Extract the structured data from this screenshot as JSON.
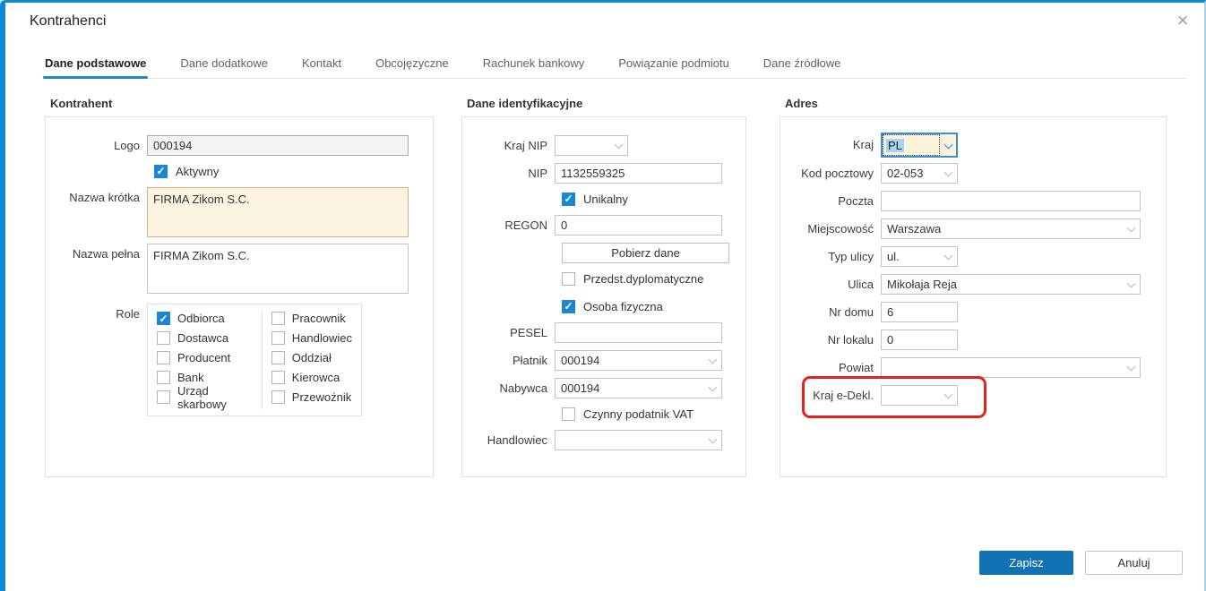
{
  "dialog": {
    "title": "Kontrahenci",
    "close_glyph": "×"
  },
  "tabs": [
    {
      "label": "Dane podstawowe",
      "active": true
    },
    {
      "label": "Dane dodatkowe",
      "active": false
    },
    {
      "label": "Kontakt",
      "active": false
    },
    {
      "label": "Obcojęzyczne",
      "active": false
    },
    {
      "label": "Rachunek bankowy",
      "active": false
    },
    {
      "label": "Powiązanie podmiotu",
      "active": false
    },
    {
      "label": "Dane źródłowe",
      "active": false
    }
  ],
  "kontrahent": {
    "header": "Kontrahent",
    "logo_label": "Logo",
    "logo_value": "000194",
    "aktywny_label": "Aktywny",
    "aktywny_checked": true,
    "nazwa_krotka_label": "Nazwa krótka",
    "nazwa_krotka_value": "FIRMA Zikom S.C.",
    "nazwa_pelna_label": "Nazwa pełna",
    "nazwa_pelna_value": "FIRMA Zikom S.C.",
    "role_label": "Role",
    "role_col1": [
      {
        "label": "Odbiorca",
        "checked": true
      },
      {
        "label": "Dostawca",
        "checked": false
      },
      {
        "label": "Producent",
        "checked": false
      },
      {
        "label": "Bank",
        "checked": false
      },
      {
        "label": "Urząd skarbowy",
        "checked": false
      }
    ],
    "role_col2": [
      {
        "label": "Pracownik",
        "checked": false
      },
      {
        "label": "Handlowiec",
        "checked": false
      },
      {
        "label": "Oddział",
        "checked": false
      },
      {
        "label": "Kierowca",
        "checked": false
      },
      {
        "label": "Przewoźnik",
        "checked": false
      }
    ]
  },
  "ident": {
    "header": "Dane identyfikacyjne",
    "kraj_nip_label": "Kraj NIP",
    "kraj_nip_value": "",
    "nip_label": "NIP",
    "nip_value": "1132559325",
    "unikalny_label": "Unikalny",
    "unikalny_checked": true,
    "regon_label": "REGON",
    "regon_value": "0",
    "pobierz_dane_label": "Pobierz dane",
    "przedst_label": "Przedst.dyplomatyczne",
    "przedst_checked": false,
    "osoba_fizyczna_label": "Osoba fizyczna",
    "osoba_fizyczna_checked": true,
    "pesel_label": "PESEL",
    "pesel_value": "",
    "platnik_label": "Płatnik",
    "platnik_value": "000194",
    "nabywca_label": "Nabywca",
    "nabywca_value": "000194",
    "vat_label": "Czynny podatnik VAT",
    "vat_checked": false,
    "handlowiec_label": "Handlowiec",
    "handlowiec_value": ""
  },
  "adres": {
    "header": "Adres",
    "kraj_label": "Kraj",
    "kraj_value": "PL",
    "kod_pocztowy_label": "Kod pocztowy",
    "kod_pocztowy_value": "02-053",
    "poczta_label": "Poczta",
    "poczta_value": "",
    "miejscowosc_label": "Miejscowość",
    "miejscowosc_value": "Warszawa",
    "typ_ulicy_label": "Typ ulicy",
    "typ_ulicy_value": "ul.",
    "ulica_label": "Ulica",
    "ulica_value": "Mikołaja Reja",
    "nr_domu_label": "Nr domu",
    "nr_domu_value": "6",
    "nr_lokalu_label": "Nr lokalu",
    "nr_lokalu_value": "0",
    "powiat_label": "Powiat",
    "powiat_value": "",
    "kraj_edekl_label": "Kraj e-Dekl.",
    "kraj_edekl_value": ""
  },
  "footer": {
    "save_label": "Zapisz",
    "cancel_label": "Anuluj"
  },
  "colors": {
    "accent_blue": "#1b87d3",
    "button_blue": "#1173b4",
    "focus_combo_border": "#3a8fd3",
    "highlight_cream": "#fdf3e1",
    "selection_blue": "#a9d4f1",
    "annotation_red": "#e0241b"
  }
}
